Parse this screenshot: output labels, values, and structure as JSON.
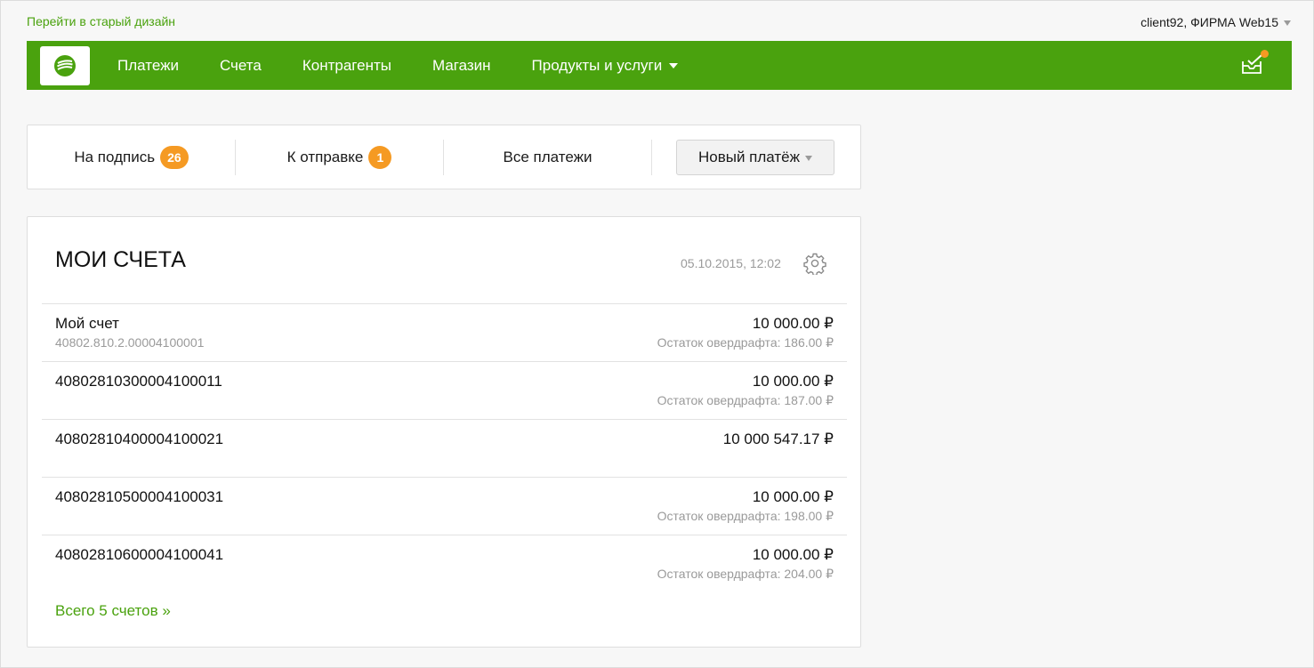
{
  "header": {
    "old_design_link": "Перейти в старый дизайн",
    "user": "client92, ФИРМА Web15"
  },
  "nav": {
    "items": [
      {
        "label": "Платежи"
      },
      {
        "label": "Счета"
      },
      {
        "label": "Контрагенты"
      },
      {
        "label": "Магазин"
      },
      {
        "label": "Продукты и услуги",
        "has_dropdown": true
      }
    ],
    "notification_indicator": true
  },
  "payments_bar": {
    "tabs": [
      {
        "label": "На подпись",
        "count": "26"
      },
      {
        "label": "К отправке",
        "count": "1"
      },
      {
        "label": "Все платежи"
      }
    ],
    "new_payment_label": "Новый платёж"
  },
  "accounts": {
    "title": "МОИ СЧЕТА",
    "updated": "05.10.2015, 12:02",
    "rows": [
      {
        "name": "Мой счет",
        "number": "40802.810.2.00004100001",
        "balance": "10 000.00 ₽",
        "overdraft": "Остаток овердрафта: 186.00 ₽"
      },
      {
        "name": "40802810300004100011",
        "number": "",
        "balance": "10 000.00 ₽",
        "overdraft": "Остаток овердрафта: 187.00 ₽"
      },
      {
        "name": "40802810400004100021",
        "number": "",
        "balance": "10 000 547.17 ₽",
        "overdraft": ""
      },
      {
        "name": "40802810500004100031",
        "number": "",
        "balance": "10 000.00 ₽",
        "overdraft": "Остаток овердрафта: 198.00 ₽"
      },
      {
        "name": "40802810600004100041",
        "number": "",
        "balance": "10 000.00 ₽",
        "overdraft": "Остаток овердрафта: 204.00 ₽"
      }
    ],
    "total_link": "Всего 5 счетов »"
  },
  "colors": {
    "brand_green": "#4aa20e",
    "badge_orange": "#f59a23",
    "muted_text": "#9a9a9a"
  },
  "icons": {
    "logo": "sberbank-logo-icon",
    "inbox": "inbox-check-icon",
    "settings": "gear-icon"
  }
}
